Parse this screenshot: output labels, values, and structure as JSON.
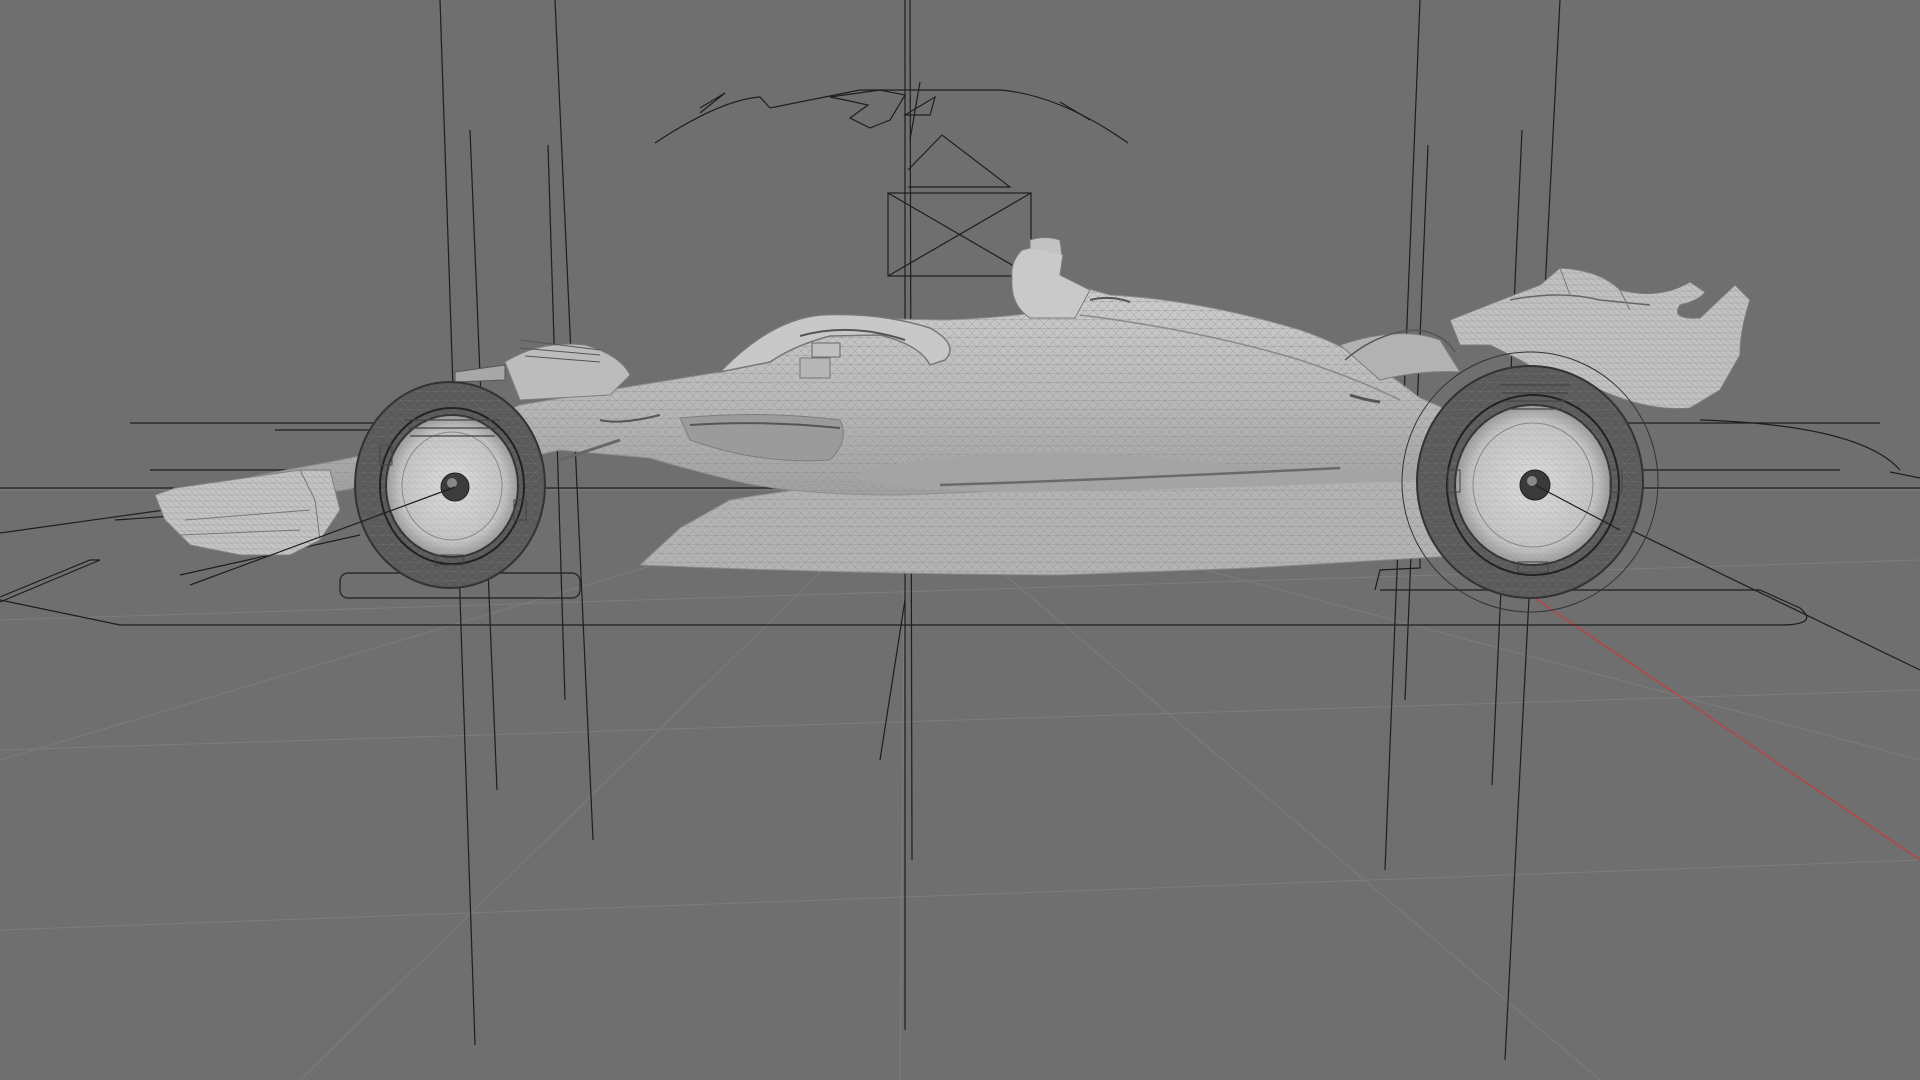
{
  "viewport": {
    "background_color": "#6f6f6f",
    "grid_line_color": "#7a7a7a",
    "axis_x_color": "#c83c3c",
    "helper_line_color": "#1e1e1e",
    "mesh_fill_color": "#bdbdbd",
    "mesh_shadow_color": "#9a9a9a",
    "tire_color": "#5a5a5a",
    "rim_color": "#d2d2d2"
  },
  "scene": {
    "object": "formula-one-car-mesh",
    "view": "side",
    "shading": "wireframe-over-solid"
  }
}
